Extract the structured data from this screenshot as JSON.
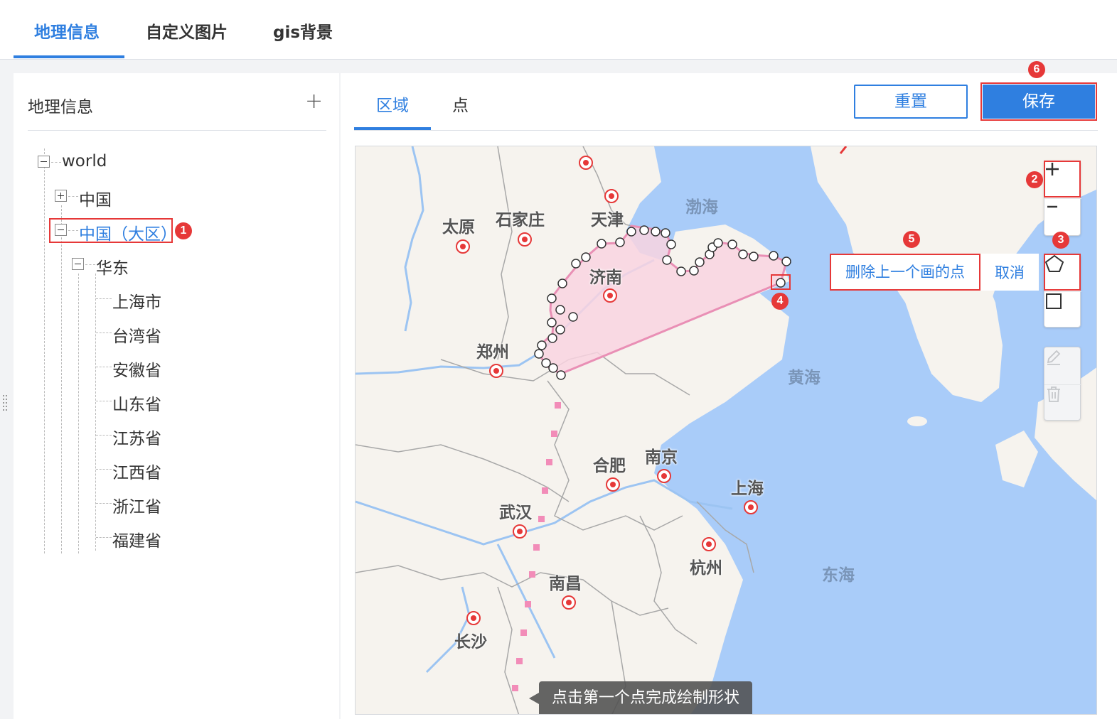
{
  "top_tabs": [
    {
      "label": "地理信息"
    },
    {
      "label": "自定义图片"
    },
    {
      "label": "gis背景"
    }
  ],
  "left": {
    "title": "地理信息",
    "add_icon": "plus-icon",
    "tree": {
      "root": "world",
      "china": "中国",
      "china_region": "中国（大区）",
      "east": "华东",
      "provinces": [
        "上海市",
        "台湾省",
        "安徽省",
        "山东省",
        "江苏省",
        "江西省",
        "浙江省",
        "福建省"
      ]
    }
  },
  "right": {
    "tabs": [
      "区域",
      "点"
    ],
    "reset_label": "重置",
    "save_label": "保存"
  },
  "map": {
    "cities": [
      "太原",
      "石家庄",
      "天津",
      "济南",
      "郑州",
      "合肥",
      "南京",
      "上海",
      "武汉",
      "南昌",
      "杭州",
      "长沙"
    ],
    "seas": [
      "渤海",
      "黄海",
      "东海"
    ],
    "actions": {
      "delete_last": "删除上一个画的点",
      "cancel": "取消"
    },
    "tooltip": "点击第一个点完成绘制形状",
    "controls": [
      "zoom-in-icon",
      "zoom-out-icon",
      "polygon-icon",
      "rectangle-icon",
      "edit-icon",
      "trash-icon"
    ]
  },
  "annotations": [
    "1",
    "2",
    "3",
    "4",
    "5",
    "6"
  ],
  "colors": {
    "accent": "#2f7fe0",
    "annotation": "#e63838",
    "sea": "#a9ccf9",
    "land": "#f6f3ee",
    "polygon_fill": "#f9d4e0"
  }
}
